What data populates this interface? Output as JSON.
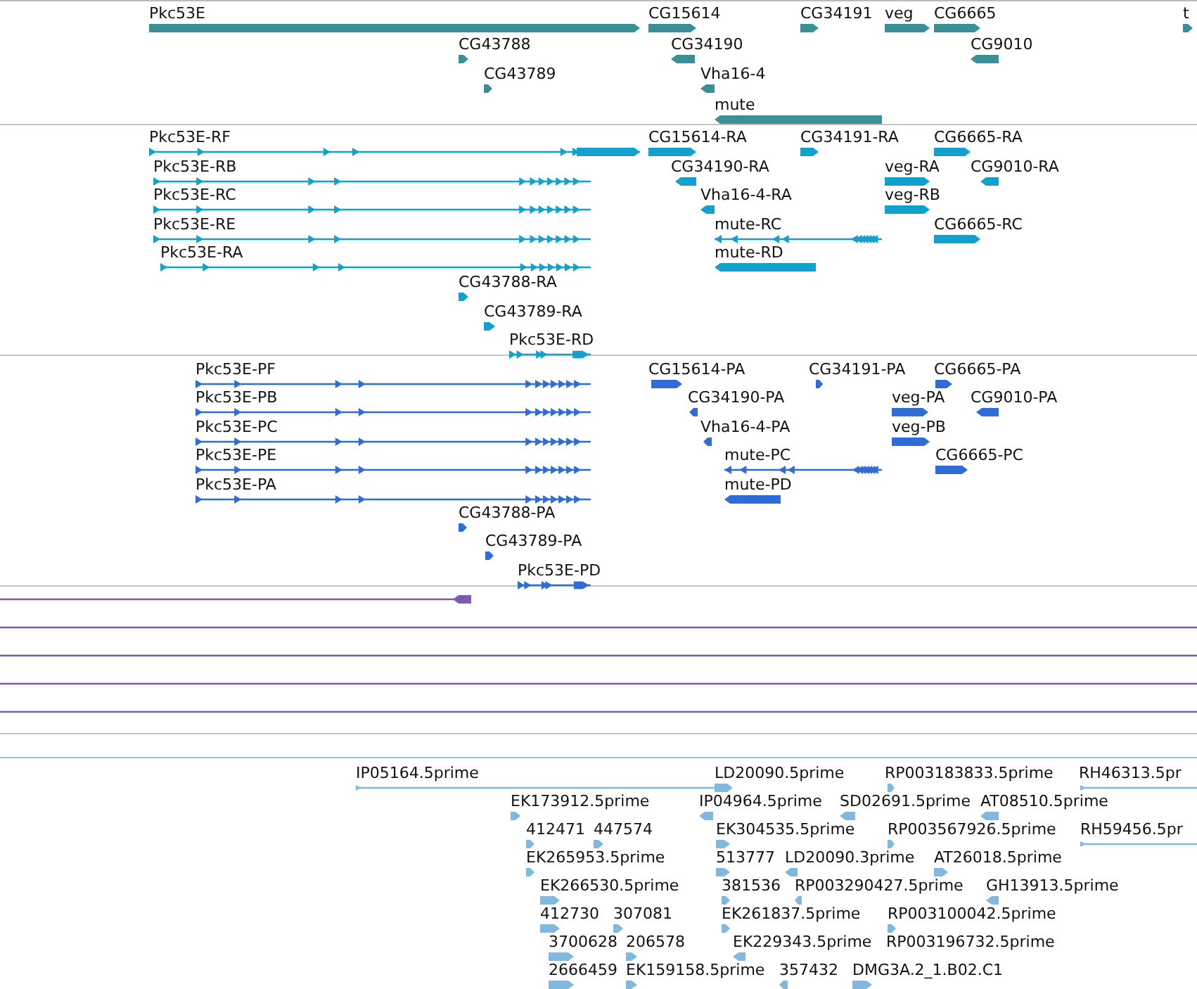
{
  "tracks": [
    {
      "kind": "gene",
      "features": [
        {
          "label": "Pkc53E",
          "reverse": false
        },
        {
          "label": "CG15614",
          "reverse": false
        },
        {
          "label": "CG34191",
          "reverse": false
        },
        {
          "label": "veg",
          "reverse": false
        },
        {
          "label": "CG6665",
          "reverse": false
        },
        {
          "label": "t",
          "reverse": false
        },
        {
          "label": "CG43788",
          "reverse": false
        },
        {
          "label": "CG34190",
          "reverse": true
        },
        {
          "label": "CG9010",
          "reverse": true
        },
        {
          "label": "CG43789",
          "reverse": false
        },
        {
          "label": "Vha16-4",
          "reverse": true
        },
        {
          "label": "mute",
          "reverse": true
        }
      ]
    },
    {
      "kind": "transcript",
      "features": [
        {
          "label": "Pkc53E-RF",
          "reverse": false
        },
        {
          "label": "CG15614-RA",
          "reverse": false
        },
        {
          "label": "CG34191-RA",
          "reverse": false
        },
        {
          "label": "CG6665-RA",
          "reverse": false
        },
        {
          "label": "Pkc53E-RB",
          "reverse": false
        },
        {
          "label": "CG34190-RA",
          "reverse": true
        },
        {
          "label": "veg-RA",
          "reverse": false
        },
        {
          "label": "CG9010-RA",
          "reverse": true
        },
        {
          "label": "Pkc53E-RC",
          "reverse": false
        },
        {
          "label": "Vha16-4-RA",
          "reverse": true
        },
        {
          "label": "veg-RB",
          "reverse": false
        },
        {
          "label": "Pkc53E-RE",
          "reverse": false
        },
        {
          "label": "mute-RC",
          "reverse": true
        },
        {
          "label": "CG6665-RC",
          "reverse": false
        },
        {
          "label": "Pkc53E-RA",
          "reverse": false
        },
        {
          "label": "mute-RD",
          "reverse": true
        },
        {
          "label": "CG43788-RA",
          "reverse": false
        },
        {
          "label": "CG43789-RA",
          "reverse": false
        },
        {
          "label": "Pkc53E-RD",
          "reverse": false
        }
      ]
    },
    {
      "kind": "protein",
      "features": [
        {
          "label": "Pkc53E-PF",
          "reverse": false
        },
        {
          "label": "CG15614-PA",
          "reverse": false
        },
        {
          "label": "CG34191-PA",
          "reverse": false
        },
        {
          "label": "CG6665-PA",
          "reverse": false
        },
        {
          "label": "Pkc53E-PB",
          "reverse": false
        },
        {
          "label": "CG34190-PA",
          "reverse": true
        },
        {
          "label": "veg-PA",
          "reverse": false
        },
        {
          "label": "CG9010-PA",
          "reverse": true
        },
        {
          "label": "Pkc53E-PC",
          "reverse": false
        },
        {
          "label": "Vha16-4-PA",
          "reverse": true
        },
        {
          "label": "veg-PB",
          "reverse": false
        },
        {
          "label": "Pkc53E-PE",
          "reverse": false
        },
        {
          "label": "mute-PC",
          "reverse": true
        },
        {
          "label": "CG6665-PC",
          "reverse": false
        },
        {
          "label": "Pkc53E-PA",
          "reverse": false
        },
        {
          "label": "mute-PD",
          "reverse": true
        },
        {
          "label": "CG43788-PA",
          "reverse": false
        },
        {
          "label": "CG43789-PA",
          "reverse": false
        },
        {
          "label": "Pkc53E-PD",
          "reverse": false
        }
      ]
    },
    {
      "kind": "alignment",
      "features": [
        {
          "kind": "block",
          "reverse": true
        },
        {
          "kind": "line"
        },
        {
          "kind": "line"
        },
        {
          "kind": "line"
        },
        {
          "kind": "line"
        }
      ]
    },
    {
      "kind": "est",
      "features": [
        {
          "label": "IP05164.5prime",
          "reverse": false
        },
        {
          "label": "LD20090.5prime",
          "reverse": false
        },
        {
          "label": "RP003183833.5prime",
          "reverse": false
        },
        {
          "label": "RH46313.5pr",
          "reverse": false
        },
        {
          "label": "EK173912.5prime",
          "reverse": false
        },
        {
          "label": "IP04964.5prime",
          "reverse": true
        },
        {
          "label": "SD02691.5prime",
          "reverse": true
        },
        {
          "label": "AT08510.5prime",
          "reverse": true
        },
        {
          "label": "412471",
          "reverse": false
        },
        {
          "label": "447574",
          "reverse": false
        },
        {
          "label": "EK304535.5prime",
          "reverse": false
        },
        {
          "label": "RP003567926.5prime",
          "reverse": false
        },
        {
          "label": "RH59456.5pr",
          "reverse": false
        },
        {
          "label": "EK265953.5prime",
          "reverse": false
        },
        {
          "label": "513777",
          "reverse": false
        },
        {
          "label": "LD20090.3prime",
          "reverse": true
        },
        {
          "label": "AT26018.5prime",
          "reverse": false
        },
        {
          "label": "EK266530.5prime",
          "reverse": false
        },
        {
          "label": "381536",
          "reverse": false
        },
        {
          "label": "RP003290427.5prime",
          "reverse": true
        },
        {
          "label": "GH13913.5prime",
          "reverse": true
        },
        {
          "label": "412730",
          "reverse": false
        },
        {
          "label": "307081",
          "reverse": false
        },
        {
          "label": "EK261837.5prime",
          "reverse": false
        },
        {
          "label": "RP003100042.5prime",
          "reverse": false
        },
        {
          "label": "3700628",
          "reverse": false
        },
        {
          "label": "206578",
          "reverse": false
        },
        {
          "label": "EK229343.5prime",
          "reverse": true
        },
        {
          "label": "RP003196732.5prime"
        },
        {
          "label": "2666459",
          "reverse": false
        },
        {
          "label": "EK159158.5prime",
          "reverse": false
        },
        {
          "label": "357432",
          "reverse": true
        },
        {
          "label": "DMG3A.2_1.B02.C1",
          "reverse": false
        }
      ]
    }
  ]
}
